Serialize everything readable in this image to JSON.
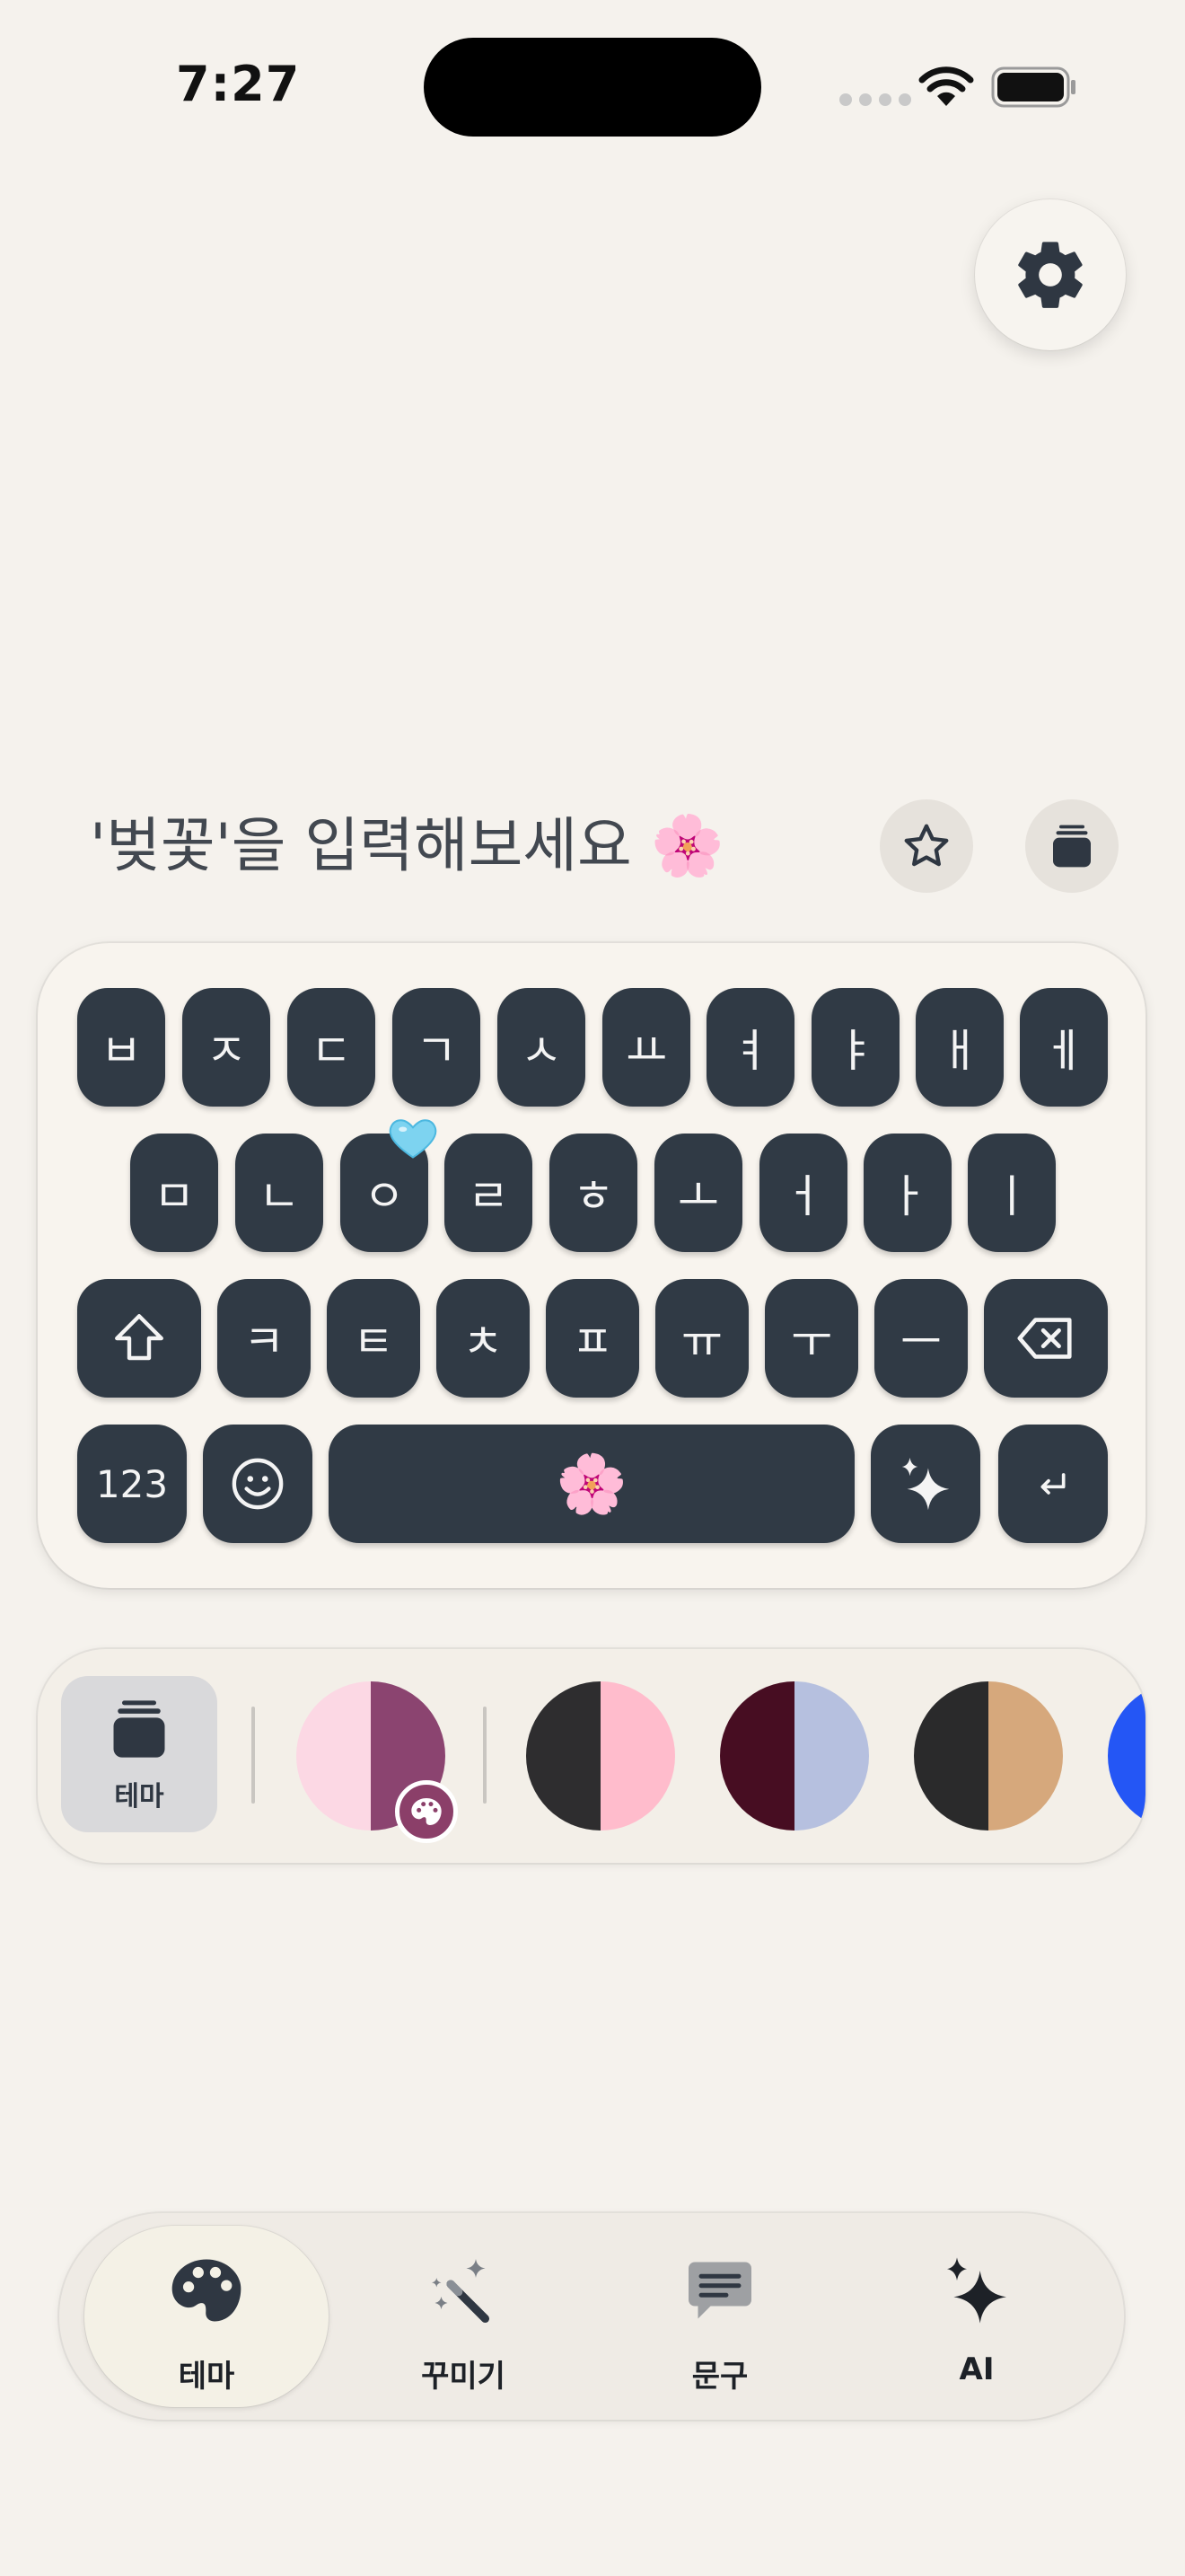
{
  "status_bar": {
    "time": "7:27"
  },
  "prompt": {
    "text": "'벚꽃'을 입력해보세요 🌸"
  },
  "keyboard": {
    "row1": [
      "ㅂ",
      "ㅈ",
      "ㄷ",
      "ㄱ",
      "ㅅ",
      "ㅛ",
      "ㅕ",
      "ㅑ",
      "ㅐ",
      "ㅔ"
    ],
    "row2": [
      "ㅁ",
      "ㄴ",
      "ㅇ",
      "ㄹ",
      "ㅎ",
      "ㅗ",
      "ㅓ",
      "ㅏ",
      "ㅣ"
    ],
    "row3": [
      "ㅋ",
      "ㅌ",
      "ㅊ",
      "ㅍ",
      "ㅠ",
      "ㅜ",
      "ㅡ"
    ],
    "numbers_label": "123",
    "space_label": "🌸",
    "heart_decoration": "light-blue-heart"
  },
  "theme_strip": {
    "tile_label": "테마",
    "swatches": [
      {
        "left": "#fcd8e4",
        "right": "#8b4470",
        "selected": true
      },
      {
        "left": "#2e2d2f",
        "right": "#ffbccc"
      },
      {
        "left": "#470d22",
        "right": "#b6c0df"
      },
      {
        "left": "#2a2a2b",
        "right": "#d6a87c"
      },
      {
        "left": "#2456f5",
        "right": "#2456f5"
      }
    ]
  },
  "bottom_nav": {
    "items": [
      {
        "label": "테마",
        "icon": "palette-icon",
        "active": true
      },
      {
        "label": "꾸미기",
        "icon": "magic-wand-icon"
      },
      {
        "label": "문구",
        "icon": "speech-bubble-icon"
      },
      {
        "label": "AI",
        "icon": "sparkles-icon"
      }
    ]
  },
  "colors": {
    "background": "#f5f2ed",
    "key": "#303a45",
    "accent": "#8b3f69"
  }
}
